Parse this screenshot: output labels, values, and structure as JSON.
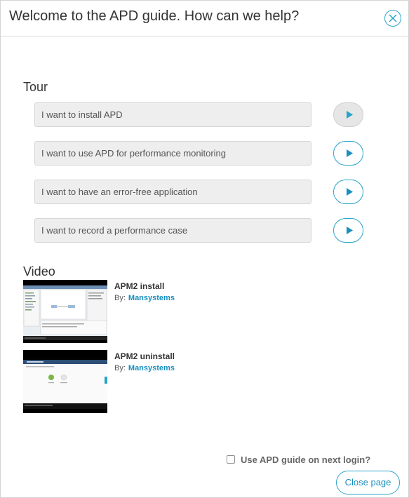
{
  "header": {
    "title": "Welcome to the APD guide. How can we help?",
    "close_icon": "close-circle-icon"
  },
  "tour": {
    "title": "Tour",
    "items": [
      {
        "label": "I want to install APD",
        "completed": true
      },
      {
        "label": "I want to use APD for performance monitoring",
        "completed": false
      },
      {
        "label": "I want to have an error-free application",
        "completed": false
      },
      {
        "label": "I want to record a performance case",
        "completed": false
      }
    ],
    "play_icon": "play-icon"
  },
  "video": {
    "title": "Video",
    "items": [
      {
        "title": "APM2 install",
        "by_label": "By:",
        "author": "Mansystems"
      },
      {
        "title": "APM2 uninstall",
        "by_label": "By:",
        "author": "Mansystems"
      }
    ]
  },
  "footer": {
    "next_login_label": "Use APD guide on next login?",
    "next_login_checked": false,
    "close_page_label": "Close page"
  },
  "colors": {
    "accent": "#29a3c9",
    "link": "#1a8fbf",
    "item_bg": "#eeeeee"
  }
}
